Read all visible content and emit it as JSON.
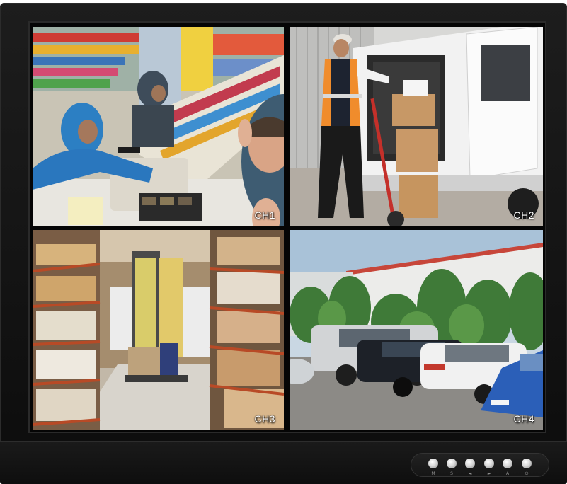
{
  "channels": [
    {
      "label": "CH1",
      "scene": "store-robbery"
    },
    {
      "label": "CH2",
      "scene": "delivery-van"
    },
    {
      "label": "CH3",
      "scene": "warehouse-aisle"
    },
    {
      "label": "CH4",
      "scene": "parking-lot"
    }
  ],
  "controls": [
    {
      "icon": "menu-icon",
      "symbol": "M"
    },
    {
      "icon": "select-icon",
      "symbol": "S"
    },
    {
      "icon": "left-arrow-icon",
      "symbol": "◄"
    },
    {
      "icon": "right-arrow-icon",
      "symbol": "►"
    },
    {
      "icon": "auto-icon",
      "symbol": "A"
    },
    {
      "icon": "power-icon",
      "symbol": "⏻"
    }
  ],
  "colors": {
    "bezel": "#141414",
    "label_text": "#ffffff",
    "button": "#d8d8d8"
  }
}
